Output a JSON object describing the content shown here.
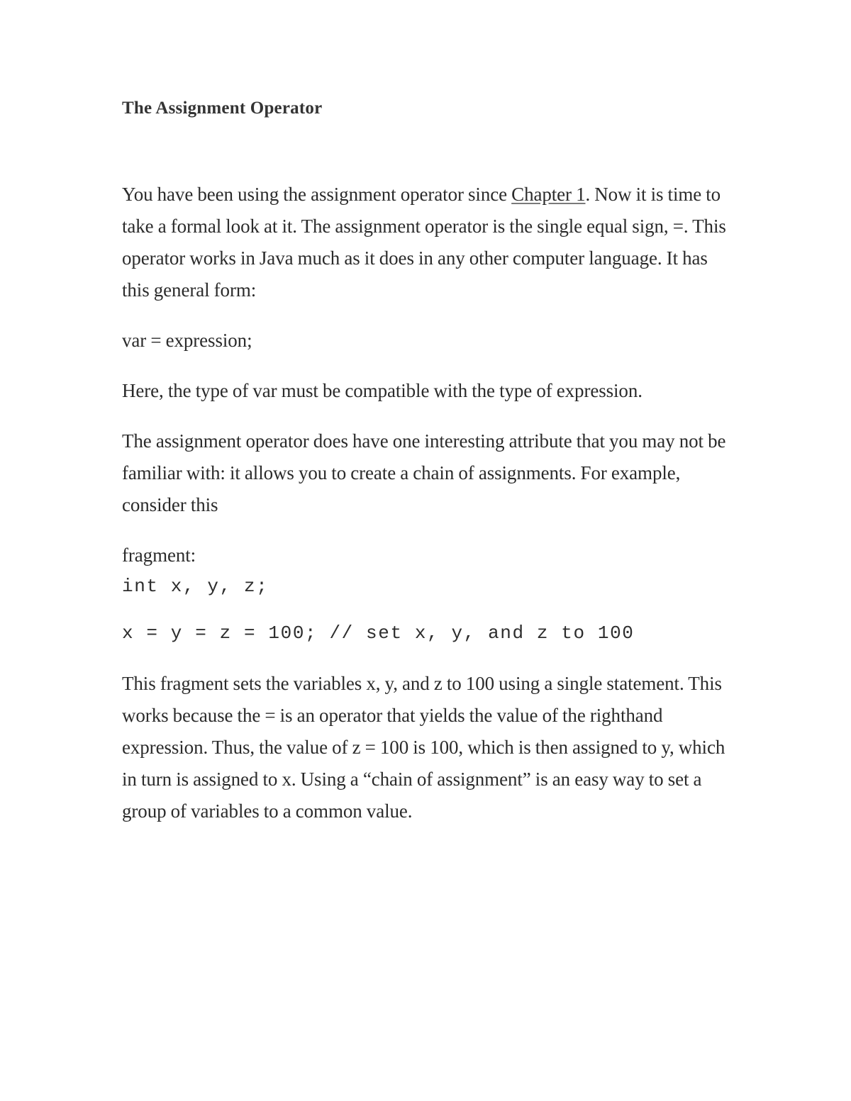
{
  "document": {
    "title": "The Assignment Operator",
    "paragraphs": {
      "p1_before_link": "You have been using the assignment operator since ",
      "p1_link": "Chapter 1",
      "p1_after_link": ". Now it is time to take a formal look at it. The assignment operator is the single equal sign, =. This operator works in Java much as it does in any other computer language. It has this general form:",
      "p2": "var = expression;",
      "p3": "Here, the type of var must be compatible with the type of expression.",
      "p4": "The assignment operator does have one interesting attribute that you may not be familiar with: it allows you to create a chain of assignments. For example, consider this",
      "p5": "fragment:",
      "p7": "This fragment sets the variables x, y, and z to 100 using a single statement. This works because the = is an operator that yields the value of the righthand expression. Thus, the value of z = 100 is 100, which is then assigned to y, which in turn is assigned to x. Using a “chain of assignment” is an easy way to set a group of variables to a common value."
    },
    "code": {
      "line1": "int x, y, z;",
      "line2": "x = y = z = 100; // set x, y, and z to 100"
    },
    "colors": {
      "page_background": "#ffffff",
      "body_text": "#2b2b2b",
      "heading_text": "#343434",
      "underline": "#7a7a7a"
    }
  }
}
